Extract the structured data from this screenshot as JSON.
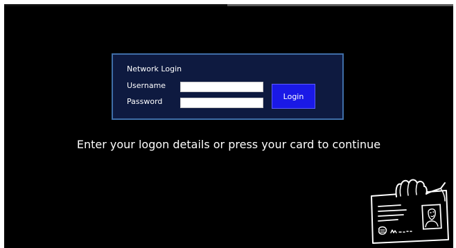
{
  "login": {
    "title": "Network Login",
    "username_label": "Username",
    "password_label": "Password",
    "username_value": "",
    "password_value": "",
    "button_label": "Login"
  },
  "instruction": "Enter your logon details or press your card to continue",
  "icons": {
    "card": "hand-holding-id-card-icon"
  },
  "colors": {
    "background": "#000000",
    "panel_bg": "#0e1a40",
    "panel_border": "#3f6ea8",
    "button_bg": "#1a19e6",
    "text": "#ffffff"
  }
}
